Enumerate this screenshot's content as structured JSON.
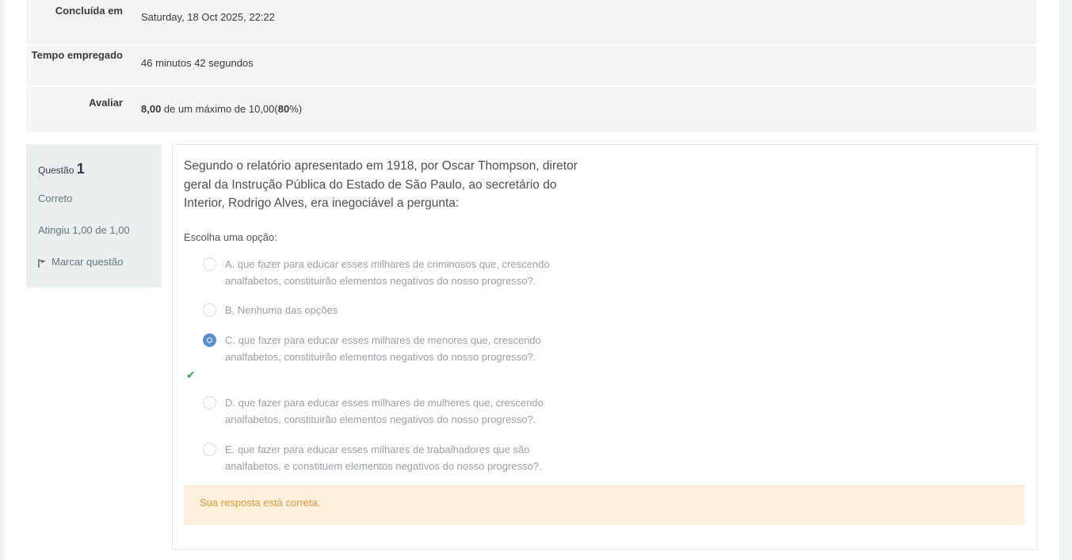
{
  "summary": {
    "rows": [
      {
        "label": "Concluída em",
        "value": "Saturday, 18 Oct 2025, 22:22"
      },
      {
        "label": "Tempo empregado",
        "value": "46 minutos 42 segundos"
      },
      {
        "label": "Avaliar",
        "grade": "8,00",
        "mid": " de um máximo de 10,00(",
        "percent": "80",
        "end": "%)"
      }
    ]
  },
  "question": {
    "label": "Questão",
    "number": "1",
    "state": "Correto",
    "grade": "Atingiu 1,00 de 1,00",
    "flag_label": "Marcar questão",
    "text": "Segundo o relatório apresentado em 1918, por Oscar Thompson, diretor geral da Instrução Pública do Estado de São Paulo, ao secretário do Interior, Rodrigo Alves, era inegociável a pergunta:",
    "prompt": "Escolha uma opção:",
    "options": [
      {
        "text": "A. que fazer para educar esses milhares de criminosos que, crescendo analfabetos, constituirão elementos negativos do nosso progresso?.",
        "checked": false
      },
      {
        "text": "B. Nenhuma das opções",
        "checked": false
      },
      {
        "text": "C. que fazer para educar esses milhares de menores que, crescendo analfabetos, constituirão elementos negativos do nosso progresso?.",
        "checked": true
      },
      {
        "text": "D. que fazer para educar esses milhares de mulheres que, crescendo analfabetos, constituirão elementos negativos do nosso progresso?.",
        "checked": false
      },
      {
        "text": "E. que fazer para educar esses milhares de trabalhadores que são analfabetos, e constituem elementos negativos do nosso progresso?.",
        "checked": false
      }
    ],
    "feedback": "Sua resposta está correta."
  },
  "colors": {
    "accent": "#5b8fcf",
    "correct": "#3aa651",
    "feedback_bg": "#fcefdc",
    "feedback_text": "#e49a3a"
  }
}
